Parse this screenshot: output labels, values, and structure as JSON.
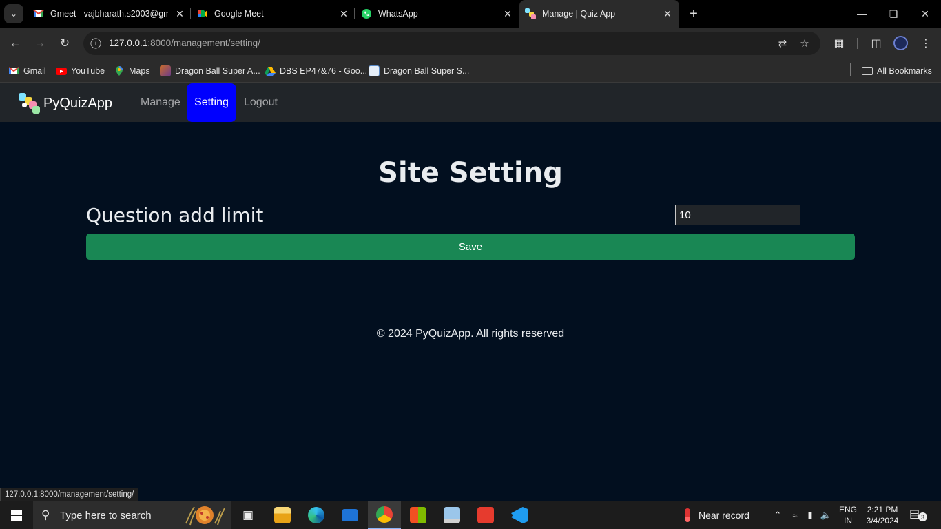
{
  "browser": {
    "tabs": [
      {
        "title": "Gmeet - vajbharath.s2003@gma",
        "icon": "gmail-icon"
      },
      {
        "title": "Google Meet",
        "icon": "google-meet-icon"
      },
      {
        "title": "WhatsApp",
        "icon": "whatsapp-icon"
      },
      {
        "title": "Manage | Quiz App",
        "icon": "quizapp-icon",
        "active": true
      }
    ],
    "address": {
      "host": "127.0.0.1",
      "path": ":8000/management/setting/"
    },
    "bookmarks": [
      {
        "label": "Gmail",
        "icon": "gmail-icon"
      },
      {
        "label": "YouTube",
        "icon": "youtube-icon"
      },
      {
        "label": "Maps",
        "icon": "maps-icon"
      },
      {
        "label": "Dragon Ball Super A...",
        "icon": "dragonball-icon"
      },
      {
        "label": "DBS EP47&76 - Goo...",
        "icon": "google-drive-icon"
      },
      {
        "label": "Dragon Ball Super S...",
        "icon": "site-icon"
      }
    ],
    "all_bookmarks": "All Bookmarks",
    "status_url": "127.0.0.1:8000/management/setting/"
  },
  "app": {
    "brand": "PyQuizApp",
    "nav": {
      "manage": "Manage",
      "setting": "Setting",
      "logout": "Logout"
    },
    "page_title": "Site Setting",
    "setting_label": "Question add limit",
    "setting_value": "10",
    "save_label": "Save",
    "footer": "© 2024 PyQuizApp. All rights reserved"
  },
  "taskbar": {
    "search_placeholder": "Type here to search",
    "weather": "Near record",
    "lang_line1": "ENG",
    "lang_line2": "IN",
    "time": "2:21 PM",
    "date": "3/4/2024",
    "notification_count": "3"
  },
  "colors": {
    "page_bg": "#020f1f",
    "navbar_bg": "#212529",
    "active_nav": "#0000ff",
    "save_button": "#198754"
  }
}
